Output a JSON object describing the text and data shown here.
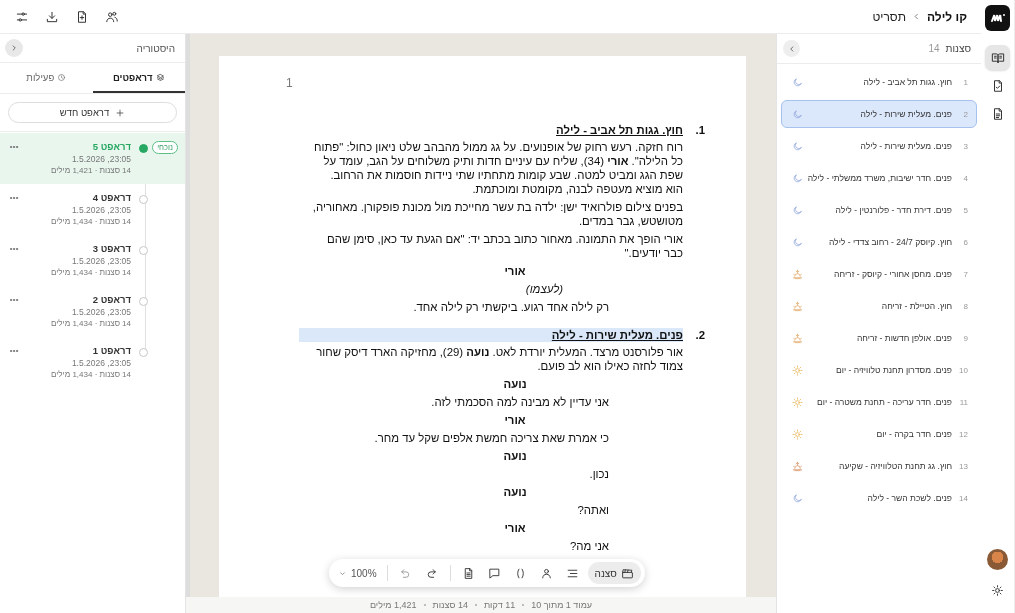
{
  "app": {
    "breadcrumb": [
      {
        "label": "קו לילה"
      },
      {
        "label": "תסריט"
      }
    ]
  },
  "top_actions": [
    {
      "kind": "sliders"
    },
    {
      "kind": "download"
    },
    {
      "kind": "file-plus"
    },
    {
      "kind": "users"
    }
  ],
  "rail": {
    "items": [
      {
        "kind": "book",
        "selected": true
      },
      {
        "kind": "file-check",
        "selected": false
      },
      {
        "kind": "document",
        "selected": false
      }
    ]
  },
  "scenes_panel": {
    "title": "סצנות",
    "count": "14",
    "scenes": [
      {
        "number": "1",
        "title": "חוץ. גגות תל אביב - לילה",
        "kind": "night",
        "selected": false
      },
      {
        "number": "2",
        "title": "פנים. מעלית שירות - לילה",
        "kind": "night",
        "selected": true
      },
      {
        "number": "3",
        "title": "פנים. מעלית שירות - לילה",
        "kind": "night",
        "selected": false
      },
      {
        "number": "4",
        "title": "פנים. חדר ישיבות, משרד ממשלתי - לילה",
        "kind": "night",
        "selected": false
      },
      {
        "number": "5",
        "title": "פנים. דירת חדר - פלורנטין - לילה",
        "kind": "night",
        "selected": false
      },
      {
        "number": "6",
        "title": "חוץ. קיוסק 24/7 - רחוב צדדי - לילה",
        "kind": "night",
        "selected": false
      },
      {
        "number": "7",
        "title": "פנים. מחסן אחורי - קיוסק - זריחה",
        "kind": "sunrise",
        "selected": false
      },
      {
        "number": "8",
        "title": "חוץ. הטיילת - זריחה",
        "kind": "sunrise",
        "selected": false
      },
      {
        "number": "9",
        "title": "פנים. אולפן חדשות - זריחה",
        "kind": "sunrise",
        "selected": false
      },
      {
        "number": "10",
        "title": "פנים. מסדרון תחנת טלוויזיה - יום",
        "kind": "day",
        "selected": false
      },
      {
        "number": "11",
        "title": "פנים. חדר עריכה - תחנת משטרה - יום",
        "kind": "day",
        "selected": false
      },
      {
        "number": "12",
        "title": "פנים. חדר בקרה - יום",
        "kind": "day",
        "selected": false
      },
      {
        "number": "13",
        "title": "חוץ. גג תחנת הטלוויזיה - שקיעה",
        "kind": "sunset",
        "selected": false
      },
      {
        "number": "14",
        "title": "פנים. לשכת השר - לילה",
        "kind": "night",
        "selected": false
      }
    ]
  },
  "document": {
    "page_number": "1",
    "scenes": [
      {
        "number": "1.",
        "heading": "חוץ. גגות תל אביב - לילה",
        "highlighted": false,
        "elements": [
          {
            "kind": "action",
            "text": "רוח חזקה. רעש רחוק של אופנועים. על גג ממול מהבהב שלט ניאון כחול: \"פתוח כל הלילה\". **אורי** (34), שליח עם עיניים חדות ותיק משלוחים על הגב, עומד על שפת הגג ומביט למטה. שבע קומות מתחתיו שתי ניידות חוסמות את הרחוב. הוא מוציא מעטפה לבנה, מקומטת ומוכתמת."
          },
          {
            "kind": "action",
            "text": "בפנים צילום פולרואיד ישן: ילדה בת עשר מחייכת מול מכונת פופקורן. מאחוריה, מטושטש, גבר במדים."
          },
          {
            "kind": "action",
            "text": "אורי הופך את התמונה. מאחור כתוב בכתב יד: \"אם הגעת עד כאן, סימן שהם כבר יודעים.\""
          },
          {
            "kind": "character",
            "text": "אורי"
          },
          {
            "kind": "parenthetical",
            "text": "(לעצמו)"
          },
          {
            "kind": "dialogue",
            "text": "רק לילה אחד רגוע. ביקשתי רק לילה אחד."
          }
        ]
      },
      {
        "number": "2.",
        "heading": "פנים. מעלית שירות - לילה",
        "highlighted": true,
        "elements": [
          {
            "kind": "action",
            "text": "אור פלורסנט מרצד. המעלית יורדת לאט. **נועה** (29), מחזיקה הארד דיסק שחור צמוד לחזה כאילו הוא לב פועם."
          },
          {
            "kind": "character",
            "text": "נועה"
          },
          {
            "kind": "dialogue",
            "text": "אני עדיין לא מבינה למה הסכמתי לזה."
          },
          {
            "kind": "character",
            "text": "אורי"
          },
          {
            "kind": "dialogue",
            "text": "כי אמרת שאת צריכה חמשת אלפים שקל עד מחר."
          },
          {
            "kind": "character",
            "text": "נועה"
          },
          {
            "kind": "dialogue",
            "text": "נכון."
          },
          {
            "kind": "character",
            "text": "נועה"
          },
          {
            "kind": "dialogue",
            "text": "ואתה?"
          },
          {
            "kind": "character",
            "text": "אורי"
          },
          {
            "kind": "dialogue",
            "text": "אני מה?"
          }
        ]
      }
    ]
  },
  "toolbar": {
    "items": [
      {
        "kind": "scene",
        "label": "סצנה",
        "selected": true
      },
      {
        "kind": "action",
        "selected": false
      },
      {
        "kind": "character",
        "selected": false
      },
      {
        "kind": "parenthetical",
        "selected": false
      },
      {
        "kind": "comment",
        "selected": false
      },
      {
        "kind": "page",
        "selected": false
      },
      {
        "kind": "redo",
        "selected": false
      },
      {
        "kind": "undo",
        "selected": false
      }
    ],
    "zoom": "100%"
  },
  "status_bar": [
    "עמוד 1 מתוך 10",
    "11 דקות",
    "14 סצנות",
    "1,421 מילים"
  ],
  "history": {
    "title": "היסטוריה",
    "tabs": [
      {
        "label": "דראפטים",
        "kind": "drafts",
        "selected": true
      },
      {
        "label": "פעילות",
        "kind": "clock",
        "selected": false
      }
    ],
    "new_button": "דראפט חדש",
    "drafts": [
      {
        "name": "דראפט 5",
        "date": "23:05, 1.5.2026",
        "stats": "14 סצנות · 1,421 מילים",
        "badge": "נוכחי",
        "selected": true
      },
      {
        "name": "דראפט 4",
        "date": "23:05, 1.5.2026",
        "stats": "14 סצנות · 1,434 מילים",
        "selected": false
      },
      {
        "name": "דראפט 3",
        "date": "23:05, 1.5.2026",
        "stats": "14 סצנות · 1,434 מילים",
        "selected": false
      },
      {
        "name": "דראפט 2",
        "date": "23:05, 1.5.2026",
        "stats": "14 סצנות · 1,434 מילים",
        "selected": false
      },
      {
        "name": "דראפט 1",
        "date": "23:05, 1.5.2026",
        "stats": "14 סצנות · 1,434 מילים",
        "selected": false
      }
    ]
  }
}
